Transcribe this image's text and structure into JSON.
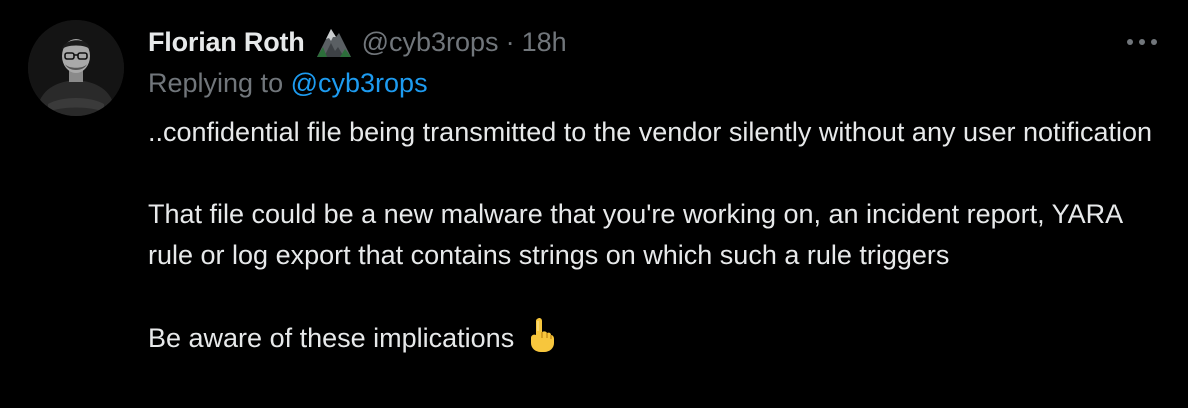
{
  "tweet": {
    "display_name": "Florian Roth",
    "badge_icon": "mountain-icon",
    "handle": "@cyb3rops",
    "separator": "·",
    "timestamp": "18h",
    "more_icon": "more-options-icon",
    "replying_prefix": "Replying to",
    "replying_mention": "@cyb3rops",
    "paragraphs": [
      "..confidential file being transmitted to the vendor silently without any user notification",
      "That file could be a new malware that you're working on, an incident report, YARA rule or log export that contains strings on which such a rule triggers",
      "Be aware of these implications"
    ],
    "final_emoji_icon": "index-pointing-up-icon"
  },
  "colors": {
    "background": "#000000",
    "text_primary": "#e7e9ea",
    "text_secondary": "#71767b",
    "link": "#1d9bf0"
  }
}
